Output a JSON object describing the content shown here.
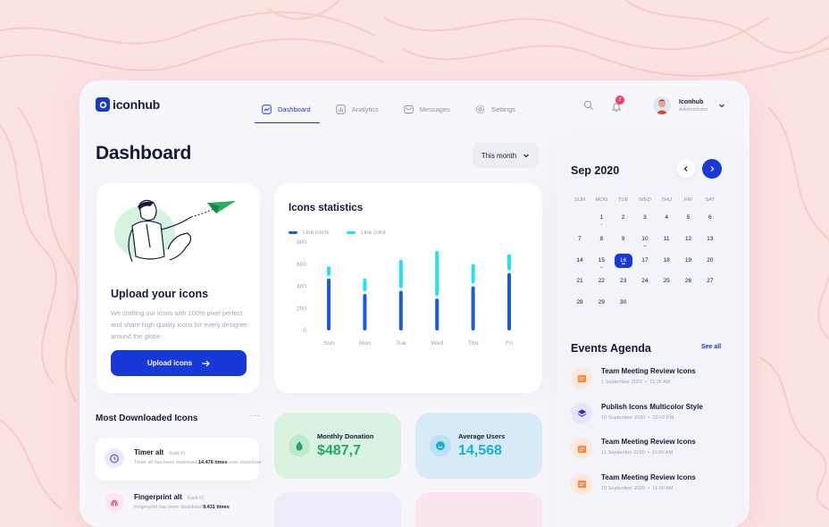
{
  "brand": {
    "name": "iconhub"
  },
  "nav": [
    {
      "label": "Dashboard",
      "active": true
    },
    {
      "label": "Analytics",
      "active": false
    },
    {
      "label": "Messages",
      "active": false
    },
    {
      "label": "Settings",
      "active": false
    }
  ],
  "notifications": {
    "count": "2"
  },
  "user": {
    "name": "Iconhub",
    "role": "Administrator"
  },
  "page": {
    "title": "Dashboard",
    "period": "This month"
  },
  "upload": {
    "title": "Upload your icons",
    "description": "We crafting our icons with 100% pixel perfect and share high quality icons for every designer around the globe",
    "button": "Upload icons"
  },
  "stats": {
    "title": "Icons statistics",
    "legend": [
      "Line icons",
      "Line color"
    ]
  },
  "chart_data": {
    "type": "bar",
    "title": "Icons statistics",
    "categories": [
      "Sun",
      "Mon",
      "Tue",
      "Wed",
      "Thu",
      "Fri"
    ],
    "yticks": [
      "0",
      "200",
      "400",
      "600",
      "800"
    ],
    "ylim": [
      0,
      800
    ],
    "stacked": true,
    "series": [
      {
        "name": "Line icons",
        "color": "#1a5ae0",
        "values": [
          470,
          330,
          360,
          290,
          400,
          520
        ]
      },
      {
        "name": "Line color",
        "color": "#1fe3f0",
        "values": [
          110,
          140,
          280,
          430,
          200,
          170
        ]
      }
    ]
  },
  "downloads": {
    "title": "Most Downloaded Icons",
    "items": [
      {
        "name": "Timer alt",
        "rank": "Rank #1",
        "desc_pre": "Timer alt has been download",
        "desc_bold": "14.476 times",
        "desc_post": "user download"
      },
      {
        "name": "Fingerprint alt",
        "rank": "Rank #2",
        "desc_pre": "Fingerprint has been download",
        "desc_bold": "9.431 times",
        "desc_post": ""
      }
    ]
  },
  "donation": {
    "label": "Monthly Donation",
    "value": "$487,7",
    "color": "#22a866"
  },
  "avg_users": {
    "label": "Average Users",
    "value": "14,568",
    "color": "#18aee0"
  },
  "calendar": {
    "title": "Sep 2020",
    "weekdays": [
      "SUN",
      "MON",
      "TUE",
      "WED",
      "THU",
      "FRI",
      "SAT"
    ],
    "weeks": [
      [
        "",
        "1",
        "2",
        "3",
        "4",
        "5",
        "6"
      ],
      [
        "7",
        "8",
        "9",
        "10",
        "11",
        "12",
        "13"
      ],
      [
        "14",
        "15",
        "16",
        "17",
        "18",
        "19",
        "20"
      ],
      [
        "21",
        "22",
        "23",
        "24",
        "25",
        "26",
        "27"
      ],
      [
        "28",
        "29",
        "30",
        "",
        "",
        "",
        ""
      ]
    ],
    "today": "16",
    "event_days": {
      "1": "•",
      "10": "•••",
      "15": "••",
      "16": "•••"
    }
  },
  "agenda": {
    "title": "Events Agenda",
    "see_all": "See all",
    "events": [
      {
        "title": "Team Meeting Review Icons",
        "date": "1 September 2020",
        "time": "11:00 AM",
        "icon": "orange"
      },
      {
        "title": "Publish Icons Multicolor Style",
        "date": "10 September 2020",
        "time": "13:00 PM",
        "icon": "purple"
      },
      {
        "title": "Team Meeting Review Icons",
        "date": "11 September 2020",
        "time": "11:00 AM",
        "icon": "orange"
      },
      {
        "title": "Team Meeting Review Icons",
        "date": "15 September 2020",
        "time": "11:00 AM",
        "icon": "orange"
      }
    ]
  }
}
